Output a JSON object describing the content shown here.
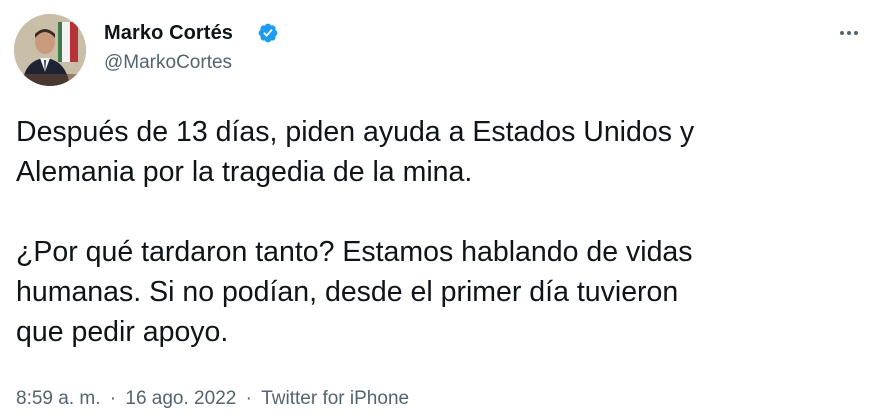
{
  "author": {
    "name": "Marko Cortés",
    "handle": "@MarkoCortes",
    "verified_icon": "verified-badge",
    "badge_color": "#1d9bf0"
  },
  "menu": {
    "icon": "more-horizontal-icon"
  },
  "tweet": {
    "text": "Después de 13 días, piden ayuda a Estados Unidos y\nAlemania por la tragedia de la mina.\n\n¿Por qué tardaron tanto? Estamos hablando de vidas\nhumanas. Si no podían, desde el primer día tuvieron\nque pedir apoyo."
  },
  "meta": {
    "time": "8:59 a. m.",
    "separator": "·",
    "date": "16 ago. 2022",
    "source": "Twitter for iPhone"
  }
}
